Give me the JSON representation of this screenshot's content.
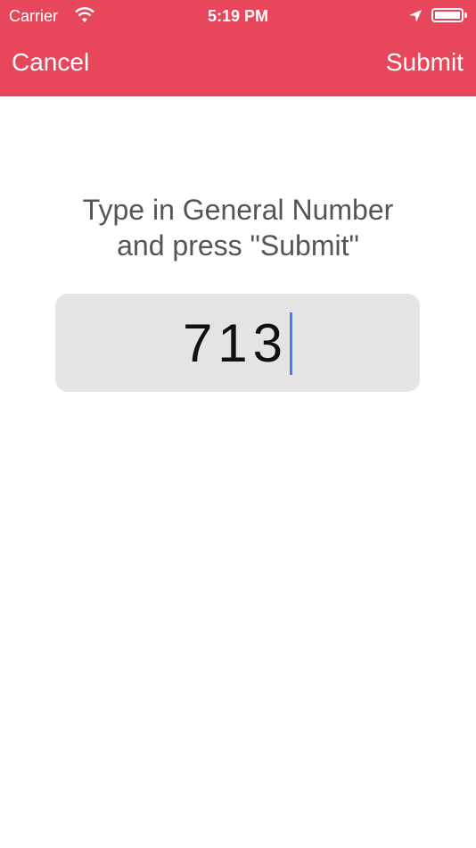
{
  "status_bar": {
    "carrier": "Carrier",
    "time": "5:19 PM",
    "icons": [
      "wifi-icon",
      "location-arrow-icon",
      "battery-icon"
    ]
  },
  "nav": {
    "cancel_label": "Cancel",
    "submit_label": "Submit"
  },
  "main": {
    "instruction_line1": "Type in General Number",
    "instruction_line2": "and press \"Submit\"",
    "number_value": "713"
  },
  "colors": {
    "accent": "#e8465a",
    "input_background": "#e4e4e4",
    "caret": "#4a7cf0"
  }
}
